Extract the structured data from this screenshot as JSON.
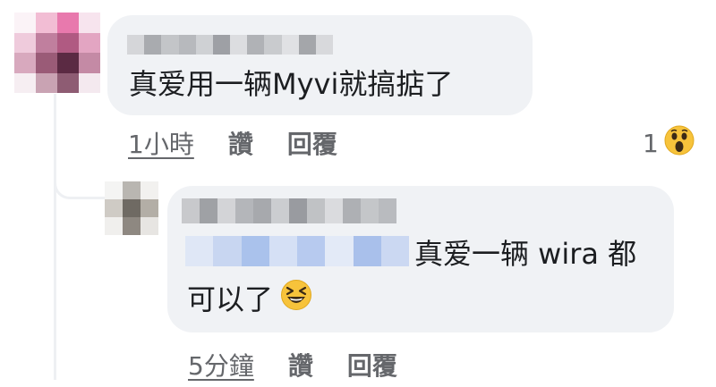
{
  "comments": [
    {
      "text": "真爱用一辆Myvi就搞掂了",
      "timestamp": "1小時",
      "like_label": "讚",
      "reply_label": "回覆",
      "reaction_count": "1",
      "reaction_icon": "wow-emoji-icon"
    },
    {
      "text_line1": "真爱一辆 wira 都",
      "text_line2": "可以了",
      "inline_emoji": "laughing-emoji-icon",
      "timestamp": "5分鐘",
      "like_label": "讚",
      "reply_label": "回覆"
    }
  ],
  "colors": {
    "bubble": "#f0f2f5",
    "meta_text": "#65676b",
    "reaction_yellow": "#f7c33b"
  }
}
